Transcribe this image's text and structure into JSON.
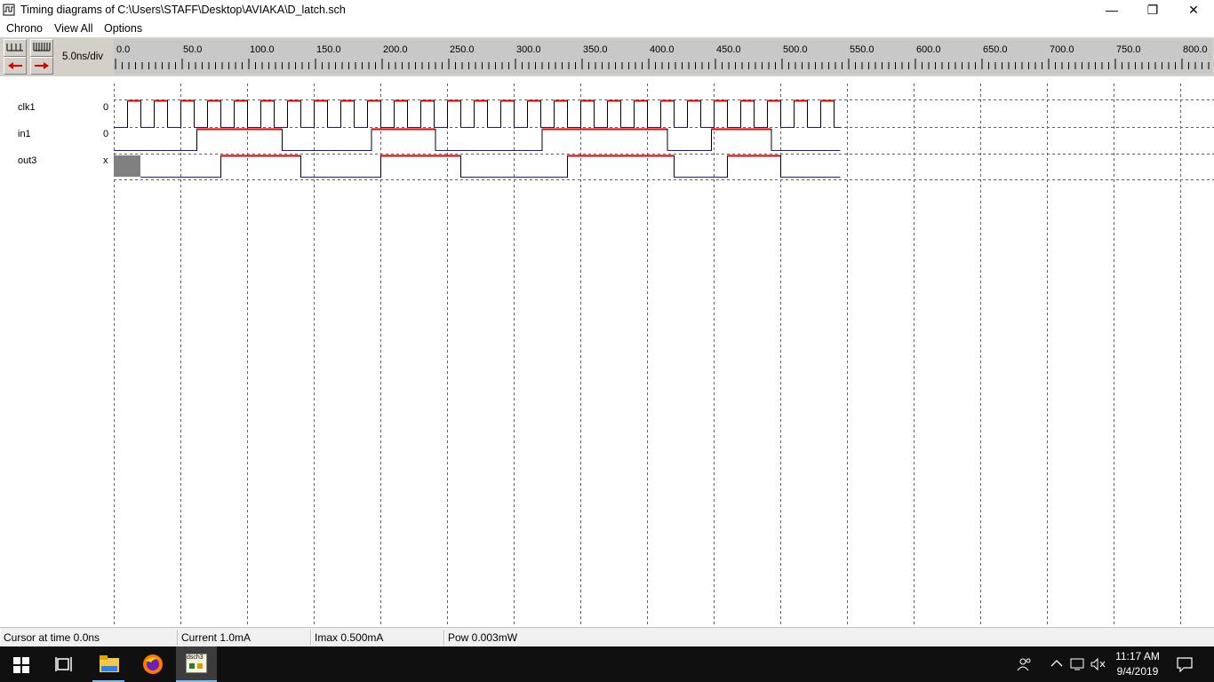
{
  "window": {
    "title": "Timing diagrams of C:\\Users\\STAFF\\Desktop\\AVIAKA\\D_latch.sch",
    "minimize_glyph": "—",
    "maximize_glyph": "❐",
    "close_glyph": "✕"
  },
  "menu": {
    "items": [
      "Chrono",
      "View All",
      "Options"
    ]
  },
  "toolbar": {
    "scale_label": "5.0ns/div",
    "zoom_out_icon": "ruler-coarse-icon",
    "zoom_in_icon": "ruler-fine-icon",
    "scroll_left_icon": "red-left-arrow-icon",
    "scroll_right_icon": "red-right-arrow-icon"
  },
  "ruler": {
    "labels": [
      "0.0",
      "50.0",
      "100.0",
      "150.0",
      "200.0",
      "250.0",
      "300.0",
      "350.0",
      "400.0",
      "450.0",
      "500.0",
      "550.0",
      "600.0",
      "650.0",
      "700.0",
      "750.0",
      "800.0"
    ]
  },
  "signals": [
    {
      "name": "clk1",
      "value": "0"
    },
    {
      "name": "in1",
      "value": "0"
    },
    {
      "name": "out3",
      "value": "x"
    }
  ],
  "chart_data": {
    "type": "timing",
    "x_unit": "ns",
    "x_range": [
      0,
      810
    ],
    "tick_labels": [
      "0.0",
      "50.0",
      "100.0",
      "150.0",
      "200.0",
      "250.0",
      "300.0",
      "350.0",
      "400.0",
      "450.0",
      "500.0",
      "550.0",
      "600.0",
      "650.0",
      "700.0",
      "750.0",
      "800.0"
    ],
    "end_time": 545,
    "series": [
      {
        "name": "clk1",
        "unknown_until": 0,
        "transitions": [
          [
            0,
            0
          ],
          [
            10,
            1
          ],
          [
            20,
            0
          ],
          [
            30,
            1
          ],
          [
            40,
            0
          ],
          [
            50,
            1
          ],
          [
            60,
            0
          ],
          [
            70,
            1
          ],
          [
            80,
            0
          ],
          [
            90,
            1
          ],
          [
            100,
            0
          ],
          [
            110,
            1
          ],
          [
            120,
            0
          ],
          [
            130,
            1
          ],
          [
            140,
            0
          ],
          [
            150,
            1
          ],
          [
            160,
            0
          ],
          [
            170,
            1
          ],
          [
            180,
            0
          ],
          [
            190,
            1
          ],
          [
            200,
            0
          ],
          [
            210,
            1
          ],
          [
            220,
            0
          ],
          [
            230,
            1
          ],
          [
            240,
            0
          ],
          [
            250,
            1
          ],
          [
            260,
            0
          ],
          [
            270,
            1
          ],
          [
            280,
            0
          ],
          [
            290,
            1
          ],
          [
            300,
            0
          ],
          [
            310,
            1
          ],
          [
            320,
            0
          ],
          [
            330,
            1
          ],
          [
            340,
            0
          ],
          [
            350,
            1
          ],
          [
            360,
            0
          ],
          [
            370,
            1
          ],
          [
            380,
            0
          ],
          [
            390,
            1
          ],
          [
            400,
            0
          ],
          [
            410,
            1
          ],
          [
            420,
            0
          ],
          [
            430,
            1
          ],
          [
            440,
            0
          ],
          [
            450,
            1
          ],
          [
            460,
            0
          ],
          [
            470,
            1
          ],
          [
            480,
            0
          ],
          [
            490,
            1
          ],
          [
            500,
            0
          ],
          [
            510,
            1
          ],
          [
            520,
            0
          ],
          [
            530,
            1
          ],
          [
            540,
            0
          ]
        ]
      },
      {
        "name": "in1",
        "unknown_until": 0,
        "transitions": [
          [
            0,
            0
          ],
          [
            62,
            1
          ],
          [
            126,
            0
          ],
          [
            193,
            1
          ],
          [
            241,
            0
          ],
          [
            321,
            1
          ],
          [
            415,
            0
          ],
          [
            448,
            1
          ],
          [
            493,
            0
          ]
        ]
      },
      {
        "name": "out3",
        "unknown_until": 20,
        "transitions": [
          [
            20,
            0
          ],
          [
            80,
            1
          ],
          [
            140,
            0
          ],
          [
            200,
            1
          ],
          [
            260,
            0
          ],
          [
            340,
            1
          ],
          [
            420,
            0
          ],
          [
            460,
            1
          ],
          [
            500,
            0
          ]
        ]
      }
    ]
  },
  "status": {
    "cursor": "Cursor at time  0.0ns",
    "current": "Current  1.0mA",
    "imax": "Imax 0.500mA",
    "pow": "Pow 0.003mW"
  },
  "taskbar": {
    "time": "11:17 AM",
    "date": "9/4/2019",
    "active_app_label": "dsch3"
  }
}
